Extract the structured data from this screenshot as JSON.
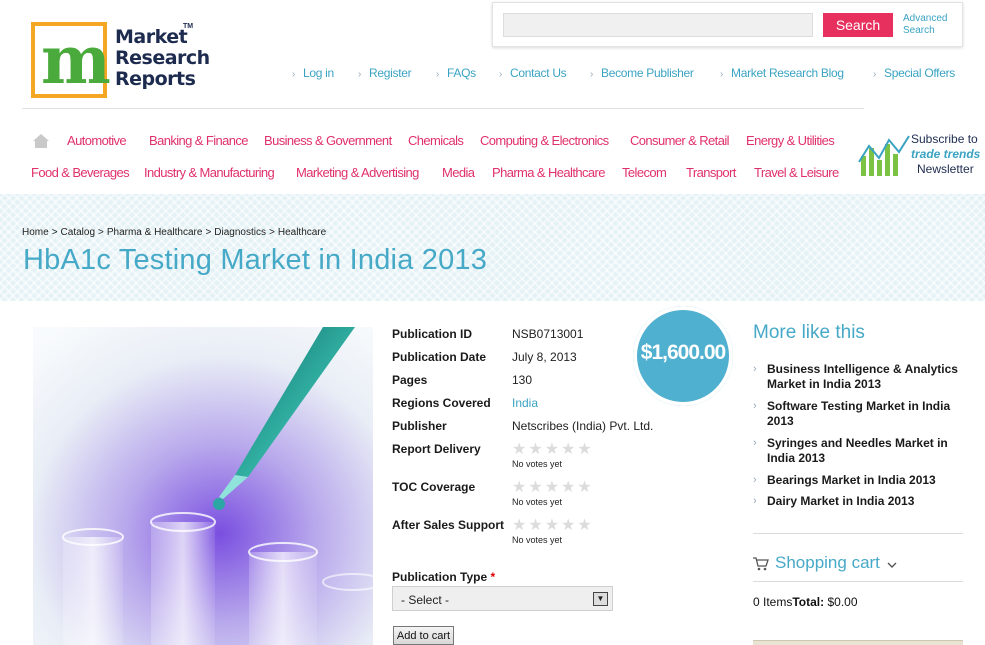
{
  "logo": {
    "line1": "Market",
    "line2": "Research",
    "line3": "Reports",
    "tm": "TM"
  },
  "search": {
    "placeholder": "",
    "button": "Search",
    "advanced_line1": "Advanced",
    "advanced_line2": "Search"
  },
  "top_links": [
    "Log in",
    "Register",
    "FAQs",
    "Contact Us",
    "Become Publisher",
    "Market Research Blog",
    "Special Offers"
  ],
  "categories_row1": [
    "Automotive",
    "Banking & Finance",
    "Business & Government",
    "Chemicals",
    "Computing & Electronics",
    "Consumer & Retail",
    "Energy & Utilities"
  ],
  "categories_row2": [
    "Food & Beverages",
    "Industry & Manufacturing",
    "Marketing & Advertising",
    "Media",
    "Pharma & Healthcare",
    "Telecom",
    "Transport",
    "Travel & Leisure"
  ],
  "newsletter": {
    "line1": "Subscribe to",
    "line2": "trade trends",
    "line3": "Newsletter"
  },
  "breadcrumb": [
    "Home",
    "Catalog",
    "Pharma & Healthcare",
    "Diagnostics",
    "Healthcare"
  ],
  "breadcrumb_sep": ">",
  "title": "HbA1c Testing Market in India 2013",
  "price": "$1,600.00",
  "details": {
    "publication_id_label": "Publication ID",
    "publication_id": "NSB0713001",
    "publication_date_label": "Publication Date",
    "publication_date": "July 8, 2013",
    "pages_label": "Pages",
    "pages": "130",
    "regions_label": "Regions Covered",
    "regions": "India",
    "publisher_label": "Publisher",
    "publisher": "Netscribes (India) Pvt. Ltd.",
    "report_delivery_label": "Report Delivery",
    "toc_coverage_label": "TOC Coverage",
    "after_sales_label": "After Sales Support",
    "no_votes": "No votes yet",
    "rating_stars": "★★★★★",
    "ratings": {
      "report_delivery": 0,
      "toc_coverage": 0,
      "after_sales": 0
    }
  },
  "publication_type": {
    "label": "Publication Type",
    "required": "*",
    "selected": "- Select -",
    "arrow": "▼"
  },
  "add_to_cart": "Add to cart",
  "more_like_this": {
    "title": "More like this",
    "items": [
      "Business Intelligence & Analytics Market in India 2013",
      "Software Testing Market in India 2013",
      "Syringes and Needles Market in India 2013",
      "Bearings Market in India 2013",
      "Dairy Market in India 2013"
    ]
  },
  "cart": {
    "title": "Shopping cart",
    "items_count": "0 Items",
    "total_label": "Total:",
    "total_value": "$0.00"
  },
  "colors": {
    "accent_pink": "#e0306a",
    "accent_blue": "#46a9c7",
    "search_button": "#e8305e"
  }
}
